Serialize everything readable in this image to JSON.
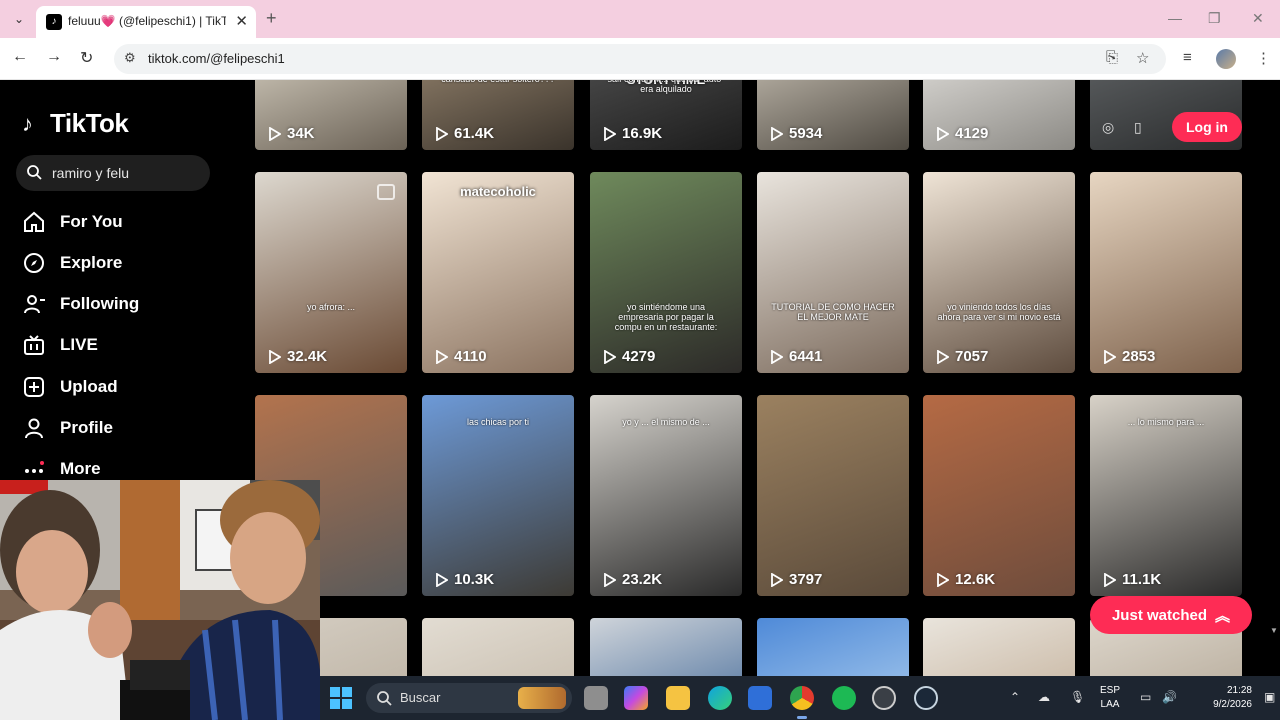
{
  "browser": {
    "tab_title": "feluuu💗 (@felipeschi1) | TikTok",
    "new_tab": "+",
    "close": "✕",
    "url": "tiktok.com/@felipeschi1",
    "win_min": "—",
    "win_restore": "❐",
    "win_close": "✕"
  },
  "tiktok": {
    "logo": "TikTok",
    "search_value": "ramiro y felu",
    "nav": [
      {
        "label": "For You",
        "icon": "home-icon"
      },
      {
        "label": "Explore",
        "icon": "compass-icon"
      },
      {
        "label": "Following",
        "icon": "following-icon"
      },
      {
        "label": "LIVE",
        "icon": "live-icon"
      },
      {
        "label": "Upload",
        "icon": "upload-icon"
      },
      {
        "label": "Profile",
        "icon": "profile-icon"
      },
      {
        "label": "More",
        "icon": "more-icon"
      }
    ],
    "login": "Log in",
    "just_watched": "Just watched",
    "videos": [
      {
        "views": "34K",
        "c1": "#c9c2b4",
        "c2": "#6b6256"
      },
      {
        "views": "61.4K",
        "c1": "#8a7a66",
        "c2": "#3a332b",
        "overlay": "cansado de estar soltero???"
      },
      {
        "views": "16.9K",
        "c1": "#4a4a4a",
        "c2": "#1c1c1c",
        "overlay_big": "STORY TIME",
        "overlay": "salí con un m... que su \"auto\" era alquilado"
      },
      {
        "views": "5934",
        "c1": "#b9b2a6",
        "c2": "#4f4a42"
      },
      {
        "views": "4129",
        "c1": "#d8d6d2",
        "c2": "#8c8a85"
      },
      {
        "views": "",
        "c1": "#5b5e60",
        "c2": "#2a2c2d"
      },
      {
        "views": "32.4K",
        "c1": "#ddd8cf",
        "c2": "#6a4a34",
        "overlay": "yo afrora: ..."
      },
      {
        "views": "4110",
        "c1": "#f1e4d4",
        "c2": "#8b7360",
        "overlay_big": "matecoholic"
      },
      {
        "views": "4279",
        "c1": "#6f8a5c",
        "c2": "#2c2a28",
        "overlay": "yo sintiéndome una empresaria por pagar la compu en un restaurante:"
      },
      {
        "views": "6441",
        "c1": "#e9e4dd",
        "c2": "#7b6a5c",
        "overlay": "TUTORIAL DE COMO HACER EL MEJOR MATE"
      },
      {
        "views": "7057",
        "c1": "#efe4d6",
        "c2": "#5e4c3e",
        "overlay": "yo viniendo todos los días ahora para ver si mi novio está"
      },
      {
        "views": "2853",
        "c1": "#e7d6c2",
        "c2": "#7e624c"
      },
      {
        "views": "",
        "c1": "#b3734d",
        "c2": "#5a5a5a"
      },
      {
        "views": "10.3K",
        "c1": "#6d9ad8",
        "c2": "#3d3a34",
        "overlay": "las chicas por ti"
      },
      {
        "views": "23.2K",
        "c1": "#d6d3cd",
        "c2": "#2a2a2a",
        "overlay": "yo y ... el mismo de ..."
      },
      {
        "views": "3797",
        "c1": "#9b8160",
        "c2": "#5a4a3a"
      },
      {
        "views": "12.6K",
        "c1": "#b56a44",
        "c2": "#6e4c3c"
      },
      {
        "views": "11.1K",
        "c1": "#d8d2c8",
        "c2": "#2a2a2a",
        "overlay": "... lo mismo para ..."
      },
      {
        "views": "",
        "c1": "#d5cec3",
        "c2": "#bfb5a6"
      },
      {
        "views": "",
        "c1": "#e2dcd2",
        "c2": "#c9bfb0"
      },
      {
        "views": "",
        "c1": "#cfd4da",
        "c2": "#5f7fa6"
      },
      {
        "views": "",
        "c1": "#4f8ad8",
        "c2": "#9bc1ea"
      },
      {
        "views": "",
        "c1": "#e9e4dc",
        "c2": "#c9b8a4"
      },
      {
        "views": "",
        "c1": "#ddd6cb",
        "c2": "#b9ae9e"
      }
    ]
  },
  "taskbar": {
    "search": "Buscar",
    "lang_top": "ESP",
    "lang_bottom": "LAA",
    "time": "21:28",
    "date": "9/2/2026",
    "tray_chevron": "⌃"
  },
  "colors": {
    "accent": "#fe2c55",
    "tabstrip": "#f4cfe0"
  }
}
